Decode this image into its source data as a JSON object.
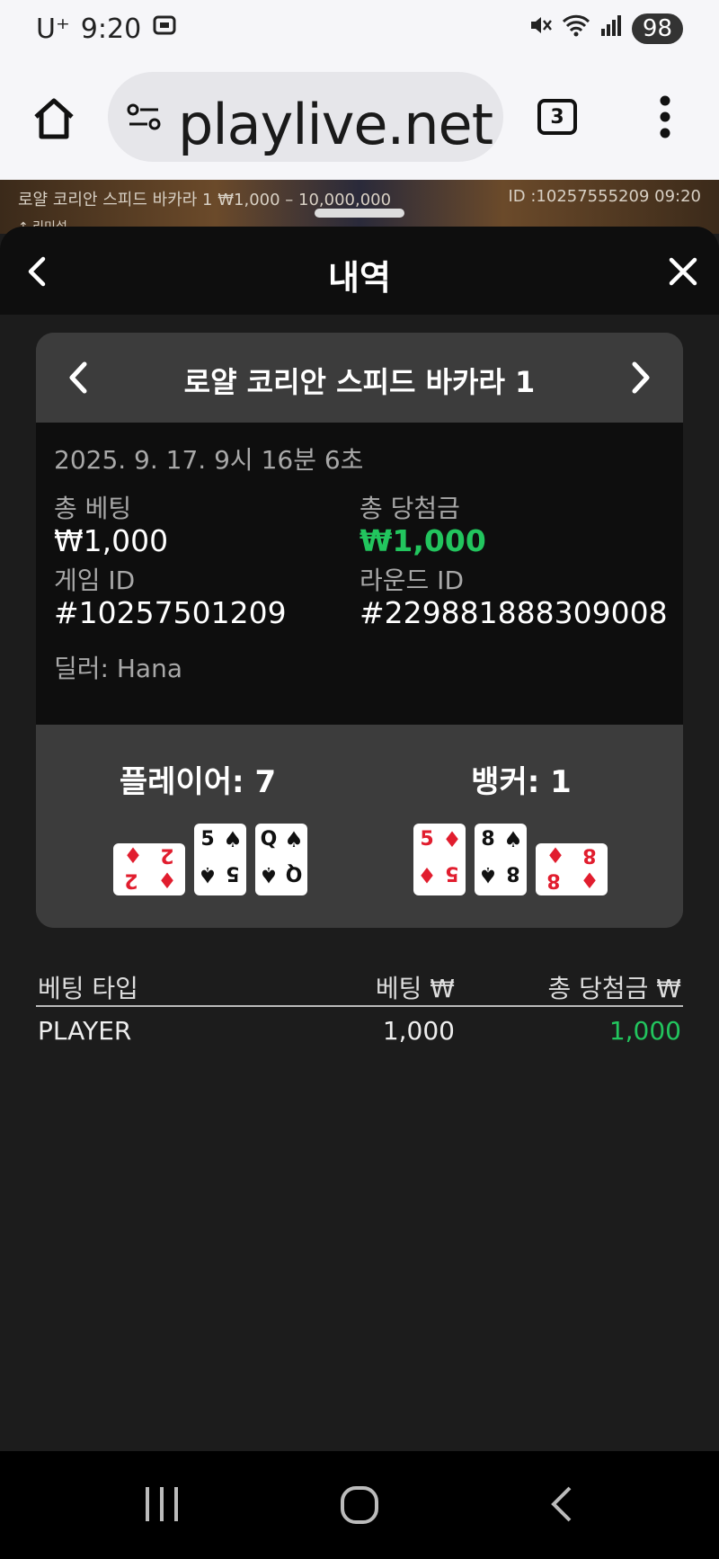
{
  "status_bar": {
    "carrier": "U⁺",
    "time": "9:20",
    "battery": "98"
  },
  "browser": {
    "url": "playlive.net",
    "tab_count": "3"
  },
  "game_strip": {
    "title": "로얄 코리안 스피드 바카라 1 ₩1,000 – 10,000,000",
    "id_time": "ID :10257555209 09:20",
    "sub": "↑ 리미설"
  },
  "sheet": {
    "title": "내역"
  },
  "round": {
    "table_name": "로얄 코리안 스피드 바카라 1",
    "datetime": "2025. 9. 17. 9시 16분 6초",
    "total_bet_label": "총 베팅",
    "total_bet_value": "₩1,000",
    "total_win_label": "총 당첨금",
    "total_win_value": "₩1,000",
    "game_id_label": "게임 ID",
    "game_id_value": "#10257501209",
    "round_id_label": "라운드 ID",
    "round_id_value": "#229881888309008",
    "dealer": "딜러: Hana"
  },
  "hands": {
    "player_title": "플레이어: 7",
    "banker_title": "뱅커: 1",
    "player_cards": [
      {
        "rank": "2",
        "suit": "♦",
        "color": "#e11d2e",
        "rotated": true
      },
      {
        "rank": "5",
        "suit": "♠",
        "color": "#111111",
        "rotated": false
      },
      {
        "rank": "Q",
        "suit": "♠",
        "color": "#111111",
        "rotated": false
      }
    ],
    "banker_cards": [
      {
        "rank": "5",
        "suit": "♦",
        "color": "#e11d2e",
        "rotated": false
      },
      {
        "rank": "8",
        "suit": "♠",
        "color": "#111111",
        "rotated": false
      },
      {
        "rank": "8",
        "suit": "♦",
        "color": "#e11d2e",
        "rotated": true
      }
    ]
  },
  "bets_table": {
    "headers": [
      "베팅 타입",
      "베팅 ₩",
      "총 당첨금 ₩"
    ],
    "rows": [
      {
        "type": "PLAYER",
        "bet": "1,000",
        "win": "1,000"
      }
    ]
  },
  "colors": {
    "win_green": "#22c55e",
    "diamond_red": "#e11d2e"
  }
}
